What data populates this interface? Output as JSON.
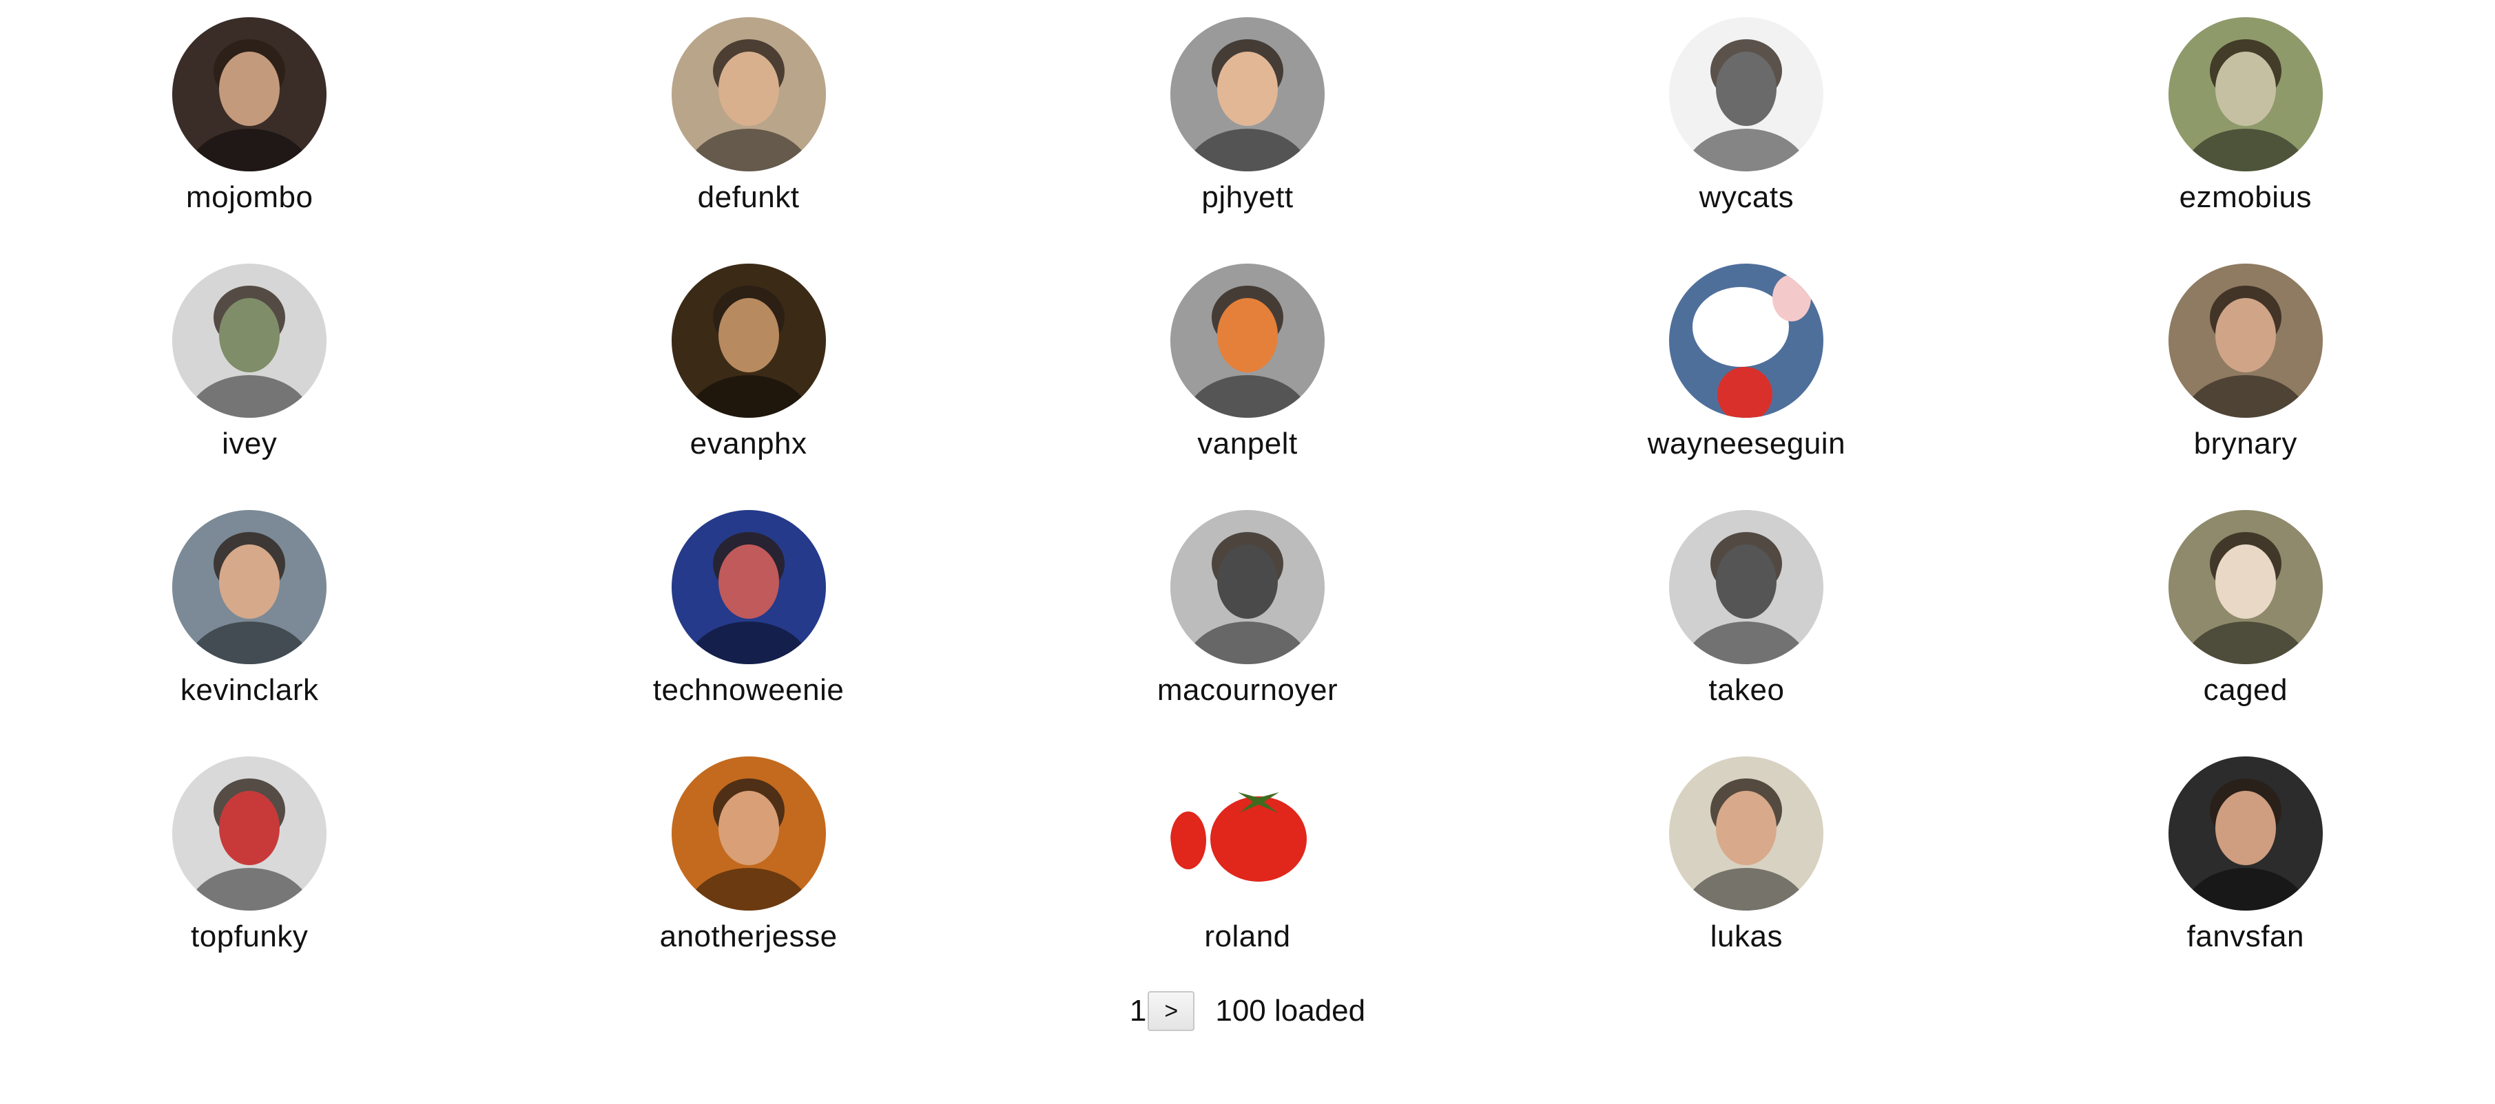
{
  "users": [
    {
      "login": "mojombo",
      "avatar_icon": "man-portrait-avatar",
      "avatar_bg": "#3a2d28",
      "avatar_fg": "#c49a7c"
    },
    {
      "login": "defunkt",
      "avatar_icon": "man-sunglasses-avatar",
      "avatar_bg": "#b9a58a",
      "avatar_fg": "#d8b08e"
    },
    {
      "login": "pjhyett",
      "avatar_icon": "man-cap-glasses-avatar",
      "avatar_bg": "#9a9a9a",
      "avatar_fg": "#e2b796"
    },
    {
      "login": "wycats",
      "avatar_icon": "man-beard-glasses-bw-avatar",
      "avatar_bg": "#f2f2f2",
      "avatar_fg": "#6a6a6a"
    },
    {
      "login": "ezmobius",
      "avatar_icon": "alien-artwork-avatar",
      "avatar_bg": "#8e9a6a",
      "avatar_fg": "#c6c0a2"
    },
    {
      "login": "ivey",
      "avatar_icon": "man-glasses-sweater-avatar",
      "avatar_bg": "#d6d6d6",
      "avatar_fg": "#7f8d68"
    },
    {
      "login": "evanphx",
      "avatar_icon": "man-speaking-dark-avatar",
      "avatar_bg": "#3b2a16",
      "avatar_fg": "#b88a60"
    },
    {
      "login": "vanpelt",
      "avatar_icon": "man-orange-shirt-logo-avatar",
      "avatar_bg": "#9c9c9c",
      "avatar_fg": "#e5803a"
    },
    {
      "login": "wayneeseguin",
      "avatar_icon": "cartoon-mouse-avatar",
      "avatar_bg": "#4f6f9b",
      "avatar_fg": "#ffffff"
    },
    {
      "login": "brynary",
      "avatar_icon": "man-glasses-wood-avatar",
      "avatar_bg": "#8f7b61",
      "avatar_fg": "#cfa487"
    },
    {
      "login": "kevinclark",
      "avatar_icon": "man-suit-avatar",
      "avatar_bg": "#7b8a96",
      "avatar_fg": "#d6a98b"
    },
    {
      "login": "technoweenie",
      "avatar_icon": "man-glasses-neon-avatar",
      "avatar_bg": "#253a8a",
      "avatar_fg": "#c15a5a"
    },
    {
      "login": "macournoyer",
      "avatar_icon": "man-bw-closeup-avatar",
      "avatar_bg": "#bcbcbc",
      "avatar_fg": "#4a4a4a"
    },
    {
      "login": "takeo",
      "avatar_icon": "man-beard-smile-bw-avatar",
      "avatar_bg": "#d0d0d0",
      "avatar_fg": "#555555"
    },
    {
      "login": "caged",
      "avatar_icon": "man-long-beard-avatar",
      "avatar_bg": "#8e8a6b",
      "avatar_fg": "#e8d8c5"
    },
    {
      "login": "topfunky",
      "avatar_icon": "flag-face-paint-avatar",
      "avatar_bg": "#d9d9d9",
      "avatar_fg": "#c83a3a"
    },
    {
      "login": "anotherjesse",
      "avatar_icon": "man-headphones-avatar",
      "avatar_bg": "#c46a1e",
      "avatar_fg": "#d9a077"
    },
    {
      "login": "roland",
      "avatar_icon": "tomato-avatar",
      "avatar_bg": "#ffffff",
      "avatar_fg": "#e1261c"
    },
    {
      "login": "lukas",
      "avatar_icon": "man-whiteboard-avatar",
      "avatar_bg": "#d8d2c2",
      "avatar_fg": "#d8a98a"
    },
    {
      "login": "fanvsfan",
      "avatar_icon": "man-office-avatar",
      "avatar_bg": "#2c2c2c",
      "avatar_fg": "#cf9d7f"
    }
  ],
  "pager": {
    "page": "1",
    "next_label": ">",
    "loaded": "100 loaded"
  }
}
